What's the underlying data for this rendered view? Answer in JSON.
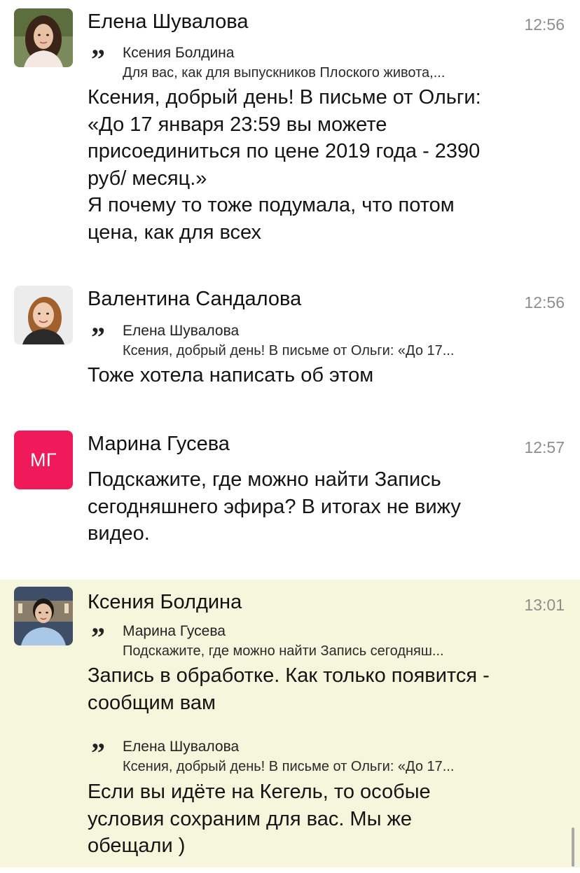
{
  "messages": [
    {
      "author": "Елена Шувалова",
      "time": "12:56",
      "avatar_icon": "avatar-photo-elena",
      "quote": {
        "author": "Ксения Болдина",
        "text": "Для вас, как для выпускников Плоского живота,..."
      },
      "text": "Ксения, добрый день! В письме от Ольги:\n«До 17 января 23:59 вы можете\nприсоединиться по цене 2019 года - 2390\nруб/ месяц.»\nЯ почему то тоже подумала, что потом\nцена, как для всех"
    },
    {
      "author": "Валентина Сандалова",
      "time": "12:56",
      "avatar_icon": "avatar-photo-valentina",
      "quote": {
        "author": "Елена Шувалова",
        "text": "Ксения, добрый день! В письме от Ольги: «До 17..."
      },
      "text": "Тоже хотела написать об этом"
    },
    {
      "author": "Марина Гусева",
      "time": "12:57",
      "avatar_initials": "МГ",
      "avatar_color": "#f0195a",
      "text": "Подскажите, где можно найти Запись\nсегодняшнего эфира? В итогах не вижу\nвидео."
    },
    {
      "author": "Ксения Болдина",
      "time": "13:01",
      "avatar_icon": "avatar-photo-kseniya",
      "highlight_color": "#f6f6dc",
      "quote": {
        "author": "Марина Гусева",
        "text": "Подскажите, где можно найти Запись сегодняш..."
      },
      "text": "Запись в обработке. Как только появится -\nсообщим вам",
      "quote2": {
        "author": "Елена Шувалова",
        "text": "Ксения, добрый день! В письме от Ольги: «До 17..."
      },
      "text2": "Если вы идёте на Кегель, то особые\nусловия сохраним для вас. Мы же\nобещали )"
    }
  ]
}
